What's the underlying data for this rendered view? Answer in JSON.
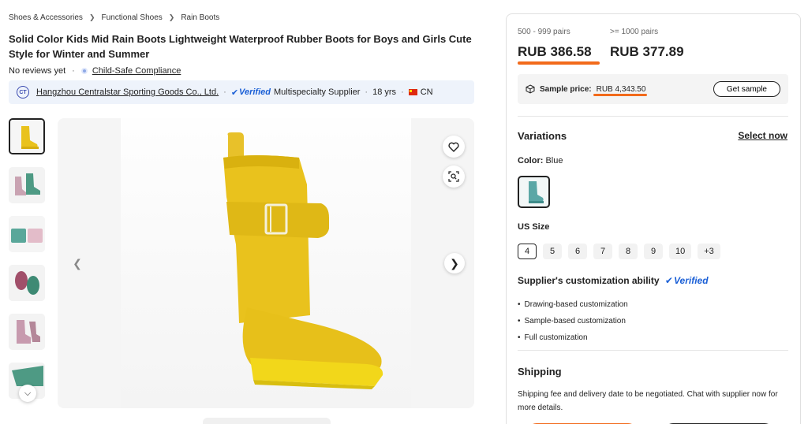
{
  "breadcrumb": [
    "Shoes & Accessories",
    "Functional Shoes",
    "Rain Boots"
  ],
  "product": {
    "title": "Solid Color Kids Mid Rain Boots Lightweight Waterproof Rubber Boots for Boys and Girls Cute Style for Winter and Summer",
    "reviews": "No reviews yet",
    "compliance": "Child-Safe Compliance"
  },
  "supplier": {
    "logo_text": "CT",
    "name": "Hangzhou Centralstar Sporting Goods Co., Ltd.",
    "verified": "Verified",
    "type": "Multispecialty Supplier",
    "years": "18 yrs",
    "country": "CN"
  },
  "gallery": {
    "thumbnails": [
      "yellow-boot",
      "pink-green-boots",
      "boot-pair-tops",
      "boot-soles",
      "pink-boots",
      "green-boot"
    ],
    "main_image": "yellow-rain-boot"
  },
  "pricing": {
    "tiers": [
      {
        "range": "500 - 999 pairs",
        "price": "RUB 386.58"
      },
      {
        "range": ">= 1000 pairs",
        "price": "RUB 377.89"
      }
    ],
    "sample_label": "Sample price:",
    "sample_price": "RUB 4,343.50",
    "get_sample": "Get sample"
  },
  "variations": {
    "title": "Variations",
    "select_now": "Select now",
    "color_label": "Color:",
    "color_value": "Blue",
    "size_title": "US Size",
    "sizes": [
      "4",
      "5",
      "6",
      "7",
      "8",
      "9",
      "10",
      "+3"
    ],
    "selected_size": "4"
  },
  "customization": {
    "title": "Supplier's customization ability",
    "verified": "Verified",
    "items": [
      "Drawing-based customization",
      "Sample-based customization",
      "Full customization"
    ]
  },
  "shipping": {
    "title": "Shipping",
    "text": "Shipping fee and delivery date to be negotiated. Chat with supplier now for more details."
  },
  "colors": {
    "accent_underline": "#f26a1b",
    "verified_blue": "#1a5fd6",
    "boot_yellow": "#e9c21d"
  }
}
